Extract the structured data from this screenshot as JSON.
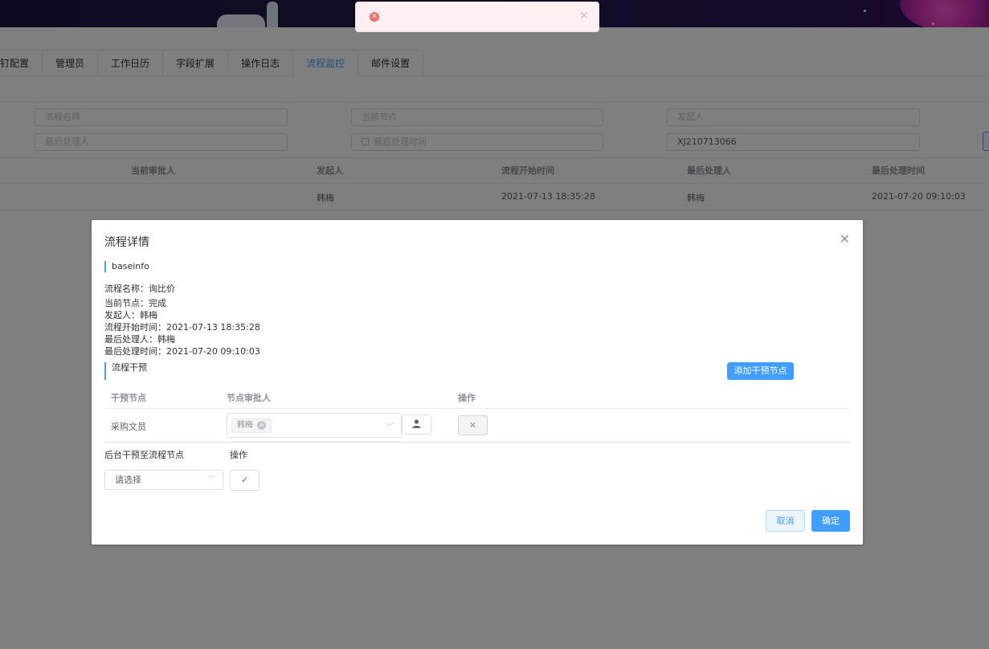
{
  "tabs": [
    "钉配置",
    "管理员",
    "工作日历",
    "字段扩展",
    "操作日志",
    "流程监控",
    "邮件设置"
  ],
  "filters": {
    "process_name_placeholder": "流程名称",
    "current_node_placeholder": "当前节点",
    "initiator_placeholder": "发起人",
    "last_handler_placeholder": "最后处理人",
    "last_handle_time_placeholder": "最后处理时间",
    "order_no_value": "XJ210713066"
  },
  "table": {
    "headers": [
      "当前审批人",
      "发起人",
      "流程开始时间",
      "最后处理人",
      "最后处理时间"
    ],
    "row": [
      "",
      "韩梅",
      "2021-07-13 18:35:28",
      "韩梅",
      "2021-07-20 09:10:03"
    ]
  },
  "toast": {
    "message": ""
  },
  "dialog": {
    "title": "流程详情",
    "section_baseinfo": "baseinfo",
    "info": [
      "流程名称：询比价",
      "当前节点：完成",
      "发起人：韩梅",
      "流程开始时间：2021-07-13 18:35:28",
      "最后处理人：韩梅",
      "最后处理时间：2021-07-20 09:10:03"
    ],
    "section_intervene": "流程干预",
    "add_node_button": "添加干预节点",
    "grid_headers": [
      "干预节点",
      "节点审批人",
      "操作"
    ],
    "grid_row": {
      "node": "采购文员",
      "approver_tag": "韩梅"
    },
    "backend_label": "后台干预至流程节点",
    "backend_op_label": "操作",
    "select_placeholder": "请选择",
    "cancel_button": "取消",
    "confirm_button": "确定"
  }
}
